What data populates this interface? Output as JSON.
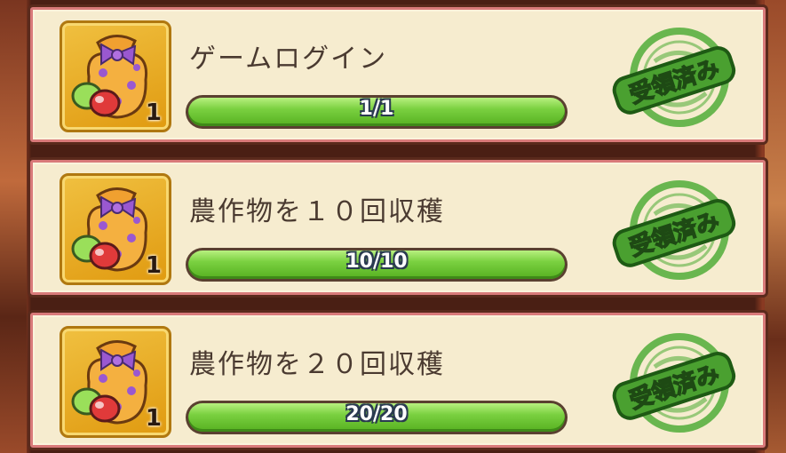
{
  "missions": [
    {
      "title": "ゲームログイン",
      "progress_text": "1/1",
      "progress_fraction": 1.0,
      "reward_count": "1",
      "reward_icon": "candy-bag-icon",
      "status_stamp": "受領済み"
    },
    {
      "title": "農作物を１０回収穫",
      "progress_text": "10/10",
      "progress_fraction": 1.0,
      "reward_count": "1",
      "reward_icon": "candy-bag-icon",
      "status_stamp": "受領済み"
    },
    {
      "title": "農作物を２０回収穫",
      "progress_text": "20/20",
      "progress_fraction": 1.0,
      "reward_count": "1",
      "reward_icon": "candy-bag-icon",
      "status_stamp": "受領済み"
    }
  ],
  "colors": {
    "card_bg": "#f6eccf",
    "card_border": "#d97a7a",
    "bar_fill": "#7ad040",
    "stamp_green": "#3fa030"
  }
}
